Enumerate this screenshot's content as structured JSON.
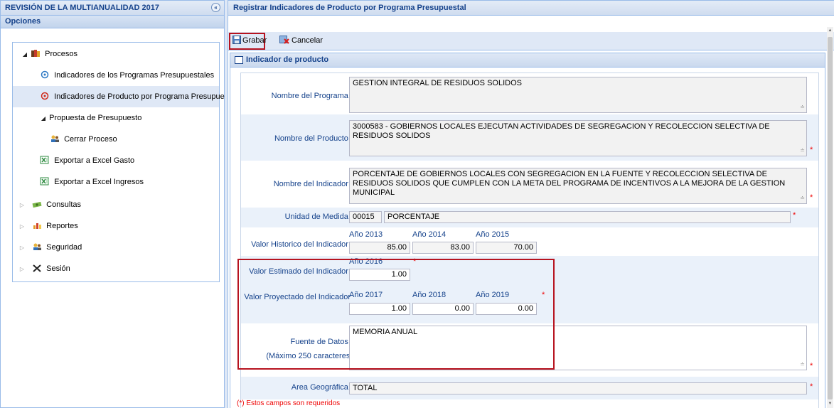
{
  "left_panel": {
    "title": "REVISIÓN DE LA MULTIANUALIDAD 2017",
    "collapse_glyph": "«",
    "options_label": "Opciones",
    "tree": [
      {
        "label": "Procesos",
        "icon": "folder-books-icon",
        "level": 0,
        "expanded": true
      },
      {
        "label": "Indicadores de los Programas Presupuestales",
        "icon": "pin-blue-icon",
        "level": 1
      },
      {
        "label": "Indicadores de Producto por Programa Presupuestal",
        "icon": "pin-red-icon",
        "level": 1,
        "selected": true
      },
      {
        "label": "Propuesta de Presupuesto",
        "icon": "",
        "level": 1,
        "expanded": true
      },
      {
        "label": "Cerrar Proceso",
        "icon": "users-icon",
        "level": 2
      },
      {
        "label": "Exportar a Excel Gasto",
        "icon": "excel-icon",
        "level": 1
      },
      {
        "label": "Exportar a Excel Ingresos",
        "icon": "excel-icon",
        "level": 1
      },
      {
        "label": "Consultas",
        "icon": "money-icon",
        "level": 0,
        "expanded": false
      },
      {
        "label": "Reportes",
        "icon": "chart-icon",
        "level": 0,
        "expanded": false
      },
      {
        "label": "Seguridad",
        "icon": "users-icon",
        "level": 0,
        "expanded": false
      },
      {
        "label": "Sesión",
        "icon": "tools-icon",
        "level": 0,
        "expanded": false
      }
    ]
  },
  "right_panel": {
    "title": "Registrar Indicadores de Producto por Programa Presupuestal",
    "toolbar": {
      "save_label": "Grabar",
      "cancel_label": "Cancelar"
    },
    "section_title": "Indicador de producto",
    "form": {
      "programa_label": "Nombre del Programa :",
      "programa_value": "GESTION INTEGRAL DE RESIDUOS SOLIDOS",
      "producto_label": "Nombre del Producto :",
      "producto_value": "3000583 - GOBIERNOS LOCALES EJECUTAN ACTIVIDADES DE SEGREGACION Y RECOLECCION SELECTIVA DE RESIDUOS SOLIDOS",
      "indicador_label": "Nombre del Indicador :",
      "indicador_value": "PORCENTAJE DE GOBIERNOS LOCALES CON SEGREGACION EN LA FUENTE Y RECOLECCION SELECTIVA DE RESIDUOS SOLIDOS QUE CUMPLEN CON LA META DEL PROGRAMA DE INCENTIVOS A LA MEJORA DE LA GESTION MUNICIPAL",
      "unidad_label": "Unidad de Medida :",
      "unidad_code": "00015",
      "unidad_value": "PORCENTAJE",
      "historico_label": "Valor Historico del Indicador :",
      "historico": [
        {
          "year": "Año 2013",
          "value": "85.00"
        },
        {
          "year": "Año 2014",
          "value": "83.00"
        },
        {
          "year": "Año 2015",
          "value": "70.00"
        }
      ],
      "estimado_label": "Valor Estimado del Indicador :",
      "estimado": {
        "year": "Año 2016",
        "value": "1.00"
      },
      "proyectado_label": "Valor Proyectado del Indicador",
      "proyectado_colon": ":",
      "proyectado": [
        {
          "year": "Año 2017",
          "value": "1.00"
        },
        {
          "year": "Año 2018",
          "value": "0.00"
        },
        {
          "year": "Año 2019",
          "value": "0.00"
        }
      ],
      "fuente_label": "Fuente de Datos :",
      "fuente_hint": "(Máximo 250 caracteres)",
      "fuente_value": "MEMORIA ANUAL",
      "area_label": "Area Geográfica :",
      "area_value": "TOTAL",
      "required_mark": "*",
      "required_note": "(*) Estos campos son requeridos"
    }
  },
  "colors": {
    "header_text": "#15428b",
    "highlight_frame": "#b7131f",
    "required": "#e00000",
    "selected_row": "#dfe8f6"
  }
}
